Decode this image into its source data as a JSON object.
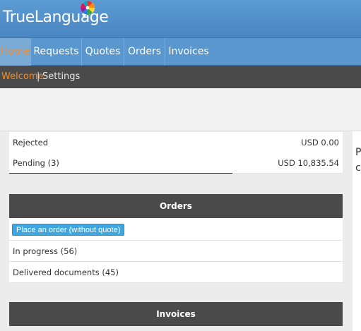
{
  "app": {
    "logo_text": "TrueLanguage"
  },
  "nav": {
    "tabs": [
      {
        "label": "Home",
        "active": true
      },
      {
        "label": "Requests"
      },
      {
        "label": "Quotes"
      },
      {
        "label": "Orders"
      },
      {
        "label": "Invoices"
      }
    ]
  },
  "subnav": {
    "items": [
      {
        "label": "Welcome",
        "active": true
      },
      {
        "label": "Settings"
      }
    ],
    "separator": "|"
  },
  "quotes_summary": {
    "rows": [
      {
        "label": "Rejected",
        "value": "USD 0.00"
      },
      {
        "label": "Pending (3)",
        "value": "USD 10,835.54"
      }
    ]
  },
  "orders_panel": {
    "title": "Orders",
    "place_order_label": "Place an order (without quote)",
    "rows": [
      {
        "label": "In progress (56)"
      },
      {
        "label": "Delivered documents (45)"
      }
    ]
  },
  "invoices_panel": {
    "title": "Invoices"
  },
  "right_edge_glyphs": [
    "P",
    "c"
  ],
  "colors": {
    "header_blue": "#5c9bd4",
    "active_orange": "#f28c28",
    "dark_bar": "#4a4a4a",
    "button_blue": "#3fa6df"
  }
}
